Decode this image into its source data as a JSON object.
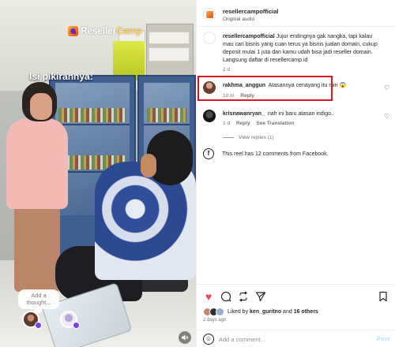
{
  "video": {
    "brand": {
      "part1": "Reseller",
      "part2": "Camp"
    },
    "caption": "Isi pikirannya:",
    "thought_placeholder": "Add a thought...",
    "icons": {
      "mute": "speaker-muted-icon"
    }
  },
  "header": {
    "username": "resellercampofficial",
    "subtitle": "Original audio"
  },
  "comments": [
    {
      "user": "resellercampofficial",
      "text": "Jujur endingnya gak nangka, tapi kalau mau cari bisnis yang cuan terus ya bisnis jualan domain, cukup deposit mulai 1 juta dan kamu udah bisa jadi reseller domain. Langsung daftar di resellercamp.id",
      "time": "2 d"
    },
    {
      "user": "rakhma_anggun",
      "text": "Atasannya cenayang itu min 😱",
      "time": "10 m",
      "reply": "Reply",
      "highlighted": true
    },
    {
      "user": "krisnawanryan_",
      "text": "nah ini baru atasan indigo..",
      "time": "1 d",
      "reply": "Reply",
      "see_translation": "See Translation"
    }
  ],
  "view_replies": "View replies (1)",
  "facebook_note": "This reel has 12 comments from Facebook.",
  "actions": {
    "icons": [
      "heart-icon",
      "comment-icon",
      "repost-icon",
      "send-icon",
      "bookmark-icon"
    ],
    "liked_by_prefix": "Liked by",
    "liked_by_user": "ken_guritno",
    "liked_by_and": "and",
    "liked_by_others": "16 others",
    "date": "2 days ago"
  },
  "add_comment": {
    "placeholder": "Add a comment…",
    "post_label": "Post"
  },
  "colors": {
    "like_red": "#ed4956",
    "highlight_red": "#e0161e",
    "post_disabled_blue": "#b2dffc"
  }
}
